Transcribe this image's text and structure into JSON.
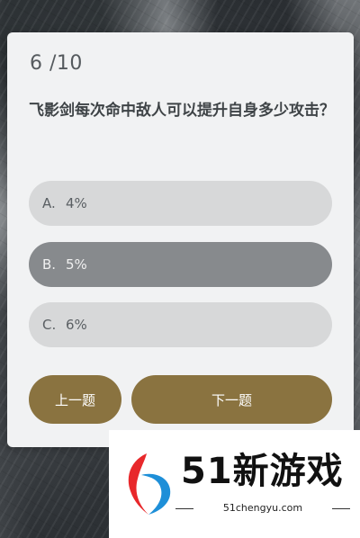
{
  "quiz": {
    "progress": "6 /10",
    "question": "飞影剑每次命中敌人可以提升自身多少攻击？",
    "options": [
      {
        "letter": "A.",
        "text": "4%"
      },
      {
        "letter": "B.",
        "text": "5%"
      },
      {
        "letter": "C.",
        "text": "6%"
      }
    ],
    "selected_option": "B.",
    "prev_label": "上一题",
    "next_label": "下一题"
  },
  "watermark": {
    "brand": "51新游戏",
    "url": "51chengyu.com",
    "colors": {
      "red": "#e8282b",
      "blue": "#1e8fd8"
    }
  },
  "colors": {
    "card_bg": "#f1f2f3",
    "option_bg": "#d7d8d9",
    "option_selected_bg": "#878a8d",
    "button_bg": "#8a7340"
  }
}
